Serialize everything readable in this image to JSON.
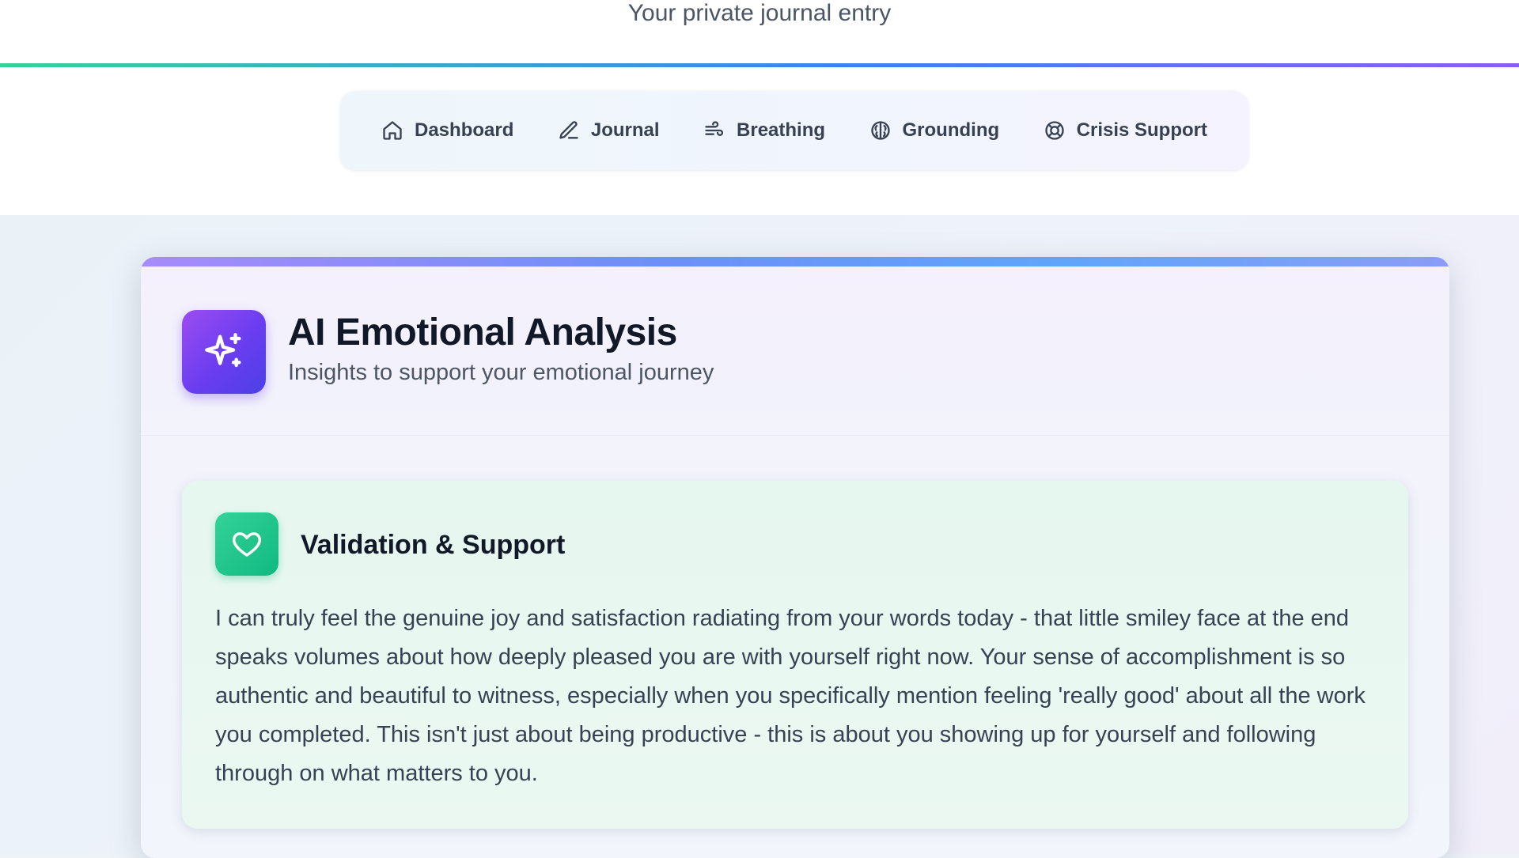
{
  "header": {
    "subtitle": "Your private journal entry",
    "accent_gradient": [
      "#34d399",
      "#3b82f6",
      "#8b5cf6"
    ]
  },
  "nav": {
    "items": [
      {
        "label": "Dashboard",
        "icon": "home-icon"
      },
      {
        "label": "Journal",
        "icon": "pencil-icon"
      },
      {
        "label": "Breathing",
        "icon": "wind-icon"
      },
      {
        "label": "Grounding",
        "icon": "brain-icon"
      },
      {
        "label": "Crisis Support",
        "icon": "lifebuoy-icon"
      }
    ]
  },
  "analysis": {
    "title": "AI Emotional Analysis",
    "subtitle": "Insights to support your emotional journey",
    "icon": "sparkles-icon",
    "icon_color": "#6a3df0",
    "validation": {
      "title": "Validation & Support",
      "icon": "heart-icon",
      "icon_color": "#10b981",
      "text": "I can truly feel the genuine joy and satisfaction radiating from your words today - that little smiley face at the end speaks volumes about how deeply pleased you are with yourself right now. Your sense of accomplishment is so authentic and beautiful to witness, especially when you specifically mention feeling 'really good' about all the work you completed. This isn't just about being productive - this is about you showing up for yourself and following through on what matters to you."
    }
  }
}
